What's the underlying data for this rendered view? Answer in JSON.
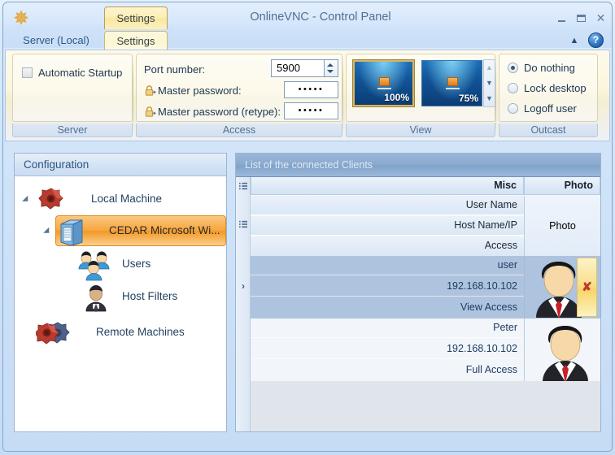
{
  "window": {
    "title": "OnlineVNC - Control Panel",
    "logo_icon": "sunburst-logo-icon",
    "caption_tab_label": "Settings",
    "minimize_label": "—",
    "maximize_label": "❐",
    "close_label": "✕"
  },
  "ribbon": {
    "tabs": [
      {
        "label": "Server (Local)",
        "selected": false
      },
      {
        "label": "Settings",
        "selected": true
      }
    ],
    "collapse_icon": "chevron-up-icon",
    "help_label": "?",
    "groups": [
      {
        "label": "Server"
      },
      {
        "label": "Access"
      },
      {
        "label": "View"
      },
      {
        "label": "Outcast"
      }
    ],
    "server_group": {
      "automatic_startup_label": "Automatic Startup",
      "automatic_startup_checked": false
    },
    "access_group": {
      "port_label": "Port number:",
      "port_value": "5900",
      "master_password_label": "Master password:",
      "master_password_value": "•••••",
      "master_password_retype_label": "Master password  (retype):",
      "master_password_retype_value": "•••••",
      "lock_icon": "lock-icon"
    },
    "view_group": {
      "thumbnails": [
        {
          "percent": "100%",
          "selected": true
        },
        {
          "percent": "75%",
          "selected": false
        }
      ],
      "scroll_up_icon": "scroll-up-icon",
      "scroll_down_icon": "scroll-down-icon",
      "scroll_more_icon": "scroll-more-icon"
    },
    "outcast_group": {
      "options": [
        {
          "label": "Do nothing",
          "selected": true
        },
        {
          "label": "Lock desktop",
          "selected": false
        },
        {
          "label": "Logoff user",
          "selected": false
        }
      ]
    }
  },
  "configuration": {
    "header": "Configuration",
    "tree": [
      {
        "label": "Local Machine",
        "icon": "red-gear-icon",
        "expanded": true,
        "selected": false
      },
      {
        "label": "CEDAR Microsoft Wi...",
        "icon": "server-tower-icon",
        "expanded": true,
        "selected": true
      },
      {
        "label": "Users",
        "icon": "users-group-icon",
        "expanded": false,
        "selected": false
      },
      {
        "label": "Host Filters",
        "icon": "person-filter-icon",
        "expanded": false,
        "selected": false
      },
      {
        "label": "Remote Machines",
        "icon": "gear-pair-icon",
        "expanded": false,
        "selected": false
      }
    ]
  },
  "clients_grid": {
    "caption": "List of the connected Clients",
    "columns": [
      {
        "label": "Misc"
      },
      {
        "label": "Photo"
      }
    ],
    "field_headers": [
      "User Name",
      "Host Name/IP",
      "Access"
    ],
    "photo_cell_label": "Photo",
    "row_indicator": "›",
    "delete_icon": "delete-x-icon",
    "grid_icon": "grid-rows-icon",
    "rows": [
      {
        "user_name": "user",
        "host": "192.168.10.102",
        "access": "View Access",
        "selected": true,
        "has_delete": true,
        "avatar_icon": "person-avatar-icon"
      },
      {
        "user_name": "Peter",
        "host": "192.168.10.102",
        "access": "Full Access",
        "selected": false,
        "has_delete": false,
        "avatar_icon": "person-avatar-icon"
      }
    ]
  },
  "colors": {
    "accent_orange": "#f29a26",
    "selection_blue": "#aec3de",
    "caption_blue": "#8aaace",
    "delete_red": "#c0392b",
    "logo_gold": "#f0a828"
  }
}
